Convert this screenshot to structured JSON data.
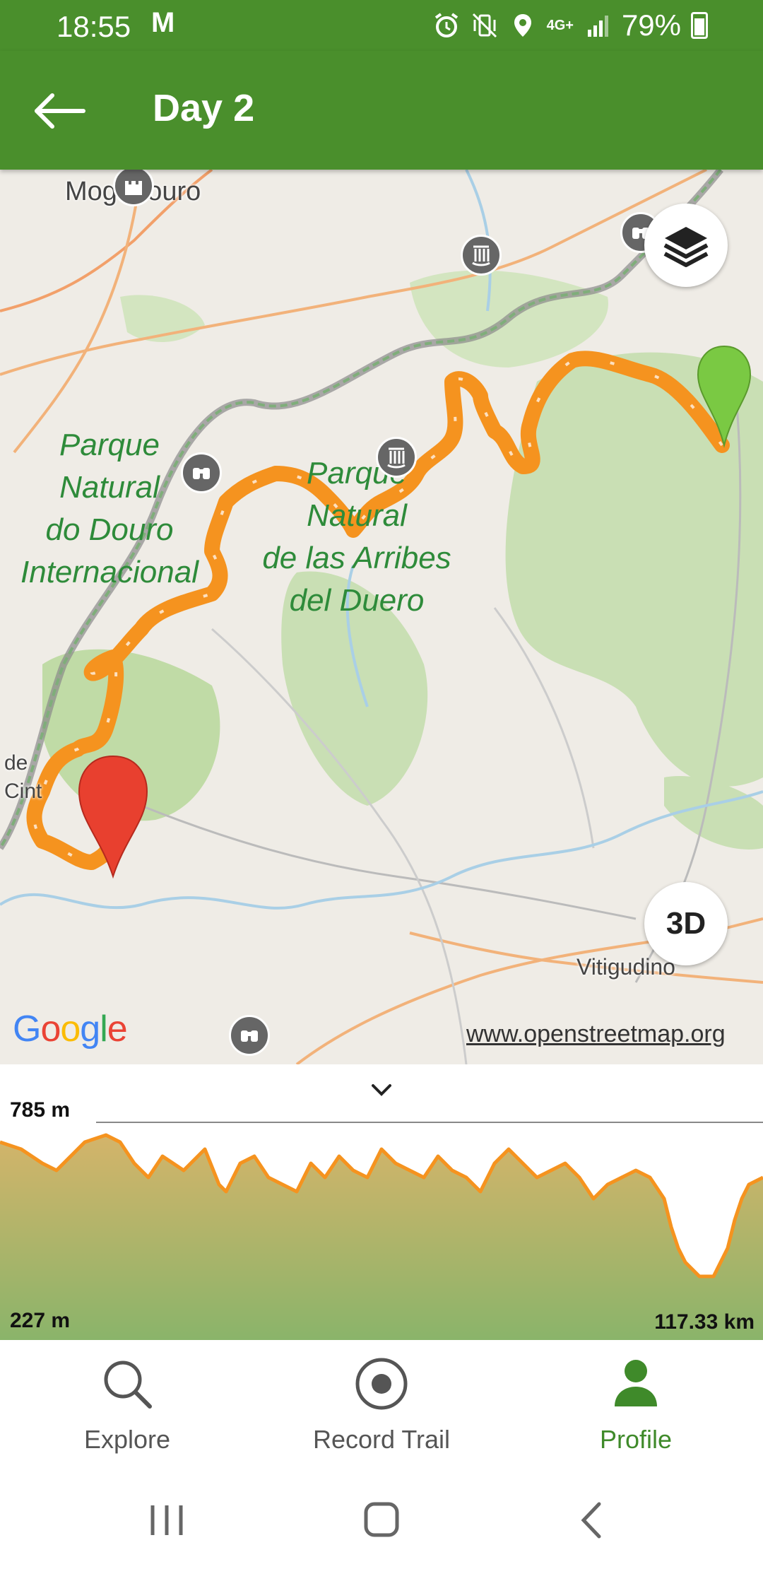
{
  "status_bar": {
    "time": "18:55",
    "notification_letter": "M",
    "network": "4G+",
    "battery": "79%",
    "icons": [
      "alarm-icon",
      "vibrate-icon",
      "location-icon",
      "signal-icon",
      "battery-icon"
    ]
  },
  "app_bar": {
    "title": "Day 2",
    "back_icon": "arrow-left-icon",
    "color": "#4a8f2c"
  },
  "map": {
    "labels": {
      "town_top": "Mogadouro",
      "park_pt": [
        "Parque",
        "Natural",
        "do Douro",
        "Internacional"
      ],
      "park_es": [
        "Parque",
        "Natural",
        "de las Arribes",
        "del Duero"
      ],
      "town_bottom": "Vitigudino",
      "edge_left": [
        "de",
        "Cint"
      ]
    },
    "attribution_logo": "Google",
    "attribution_link": "www.openstreetmap.org",
    "button_3d": "3D",
    "layers_icon": "layers-icon",
    "route_color": "#f5931f",
    "start_marker_color": "#7ac943",
    "end_marker_color": "#e8402f"
  },
  "elevation_profile": {
    "max_label": "785 m",
    "min_label": "227 m",
    "distance_label": "117.33 km",
    "collapse_icon": "chevron-down-icon"
  },
  "bottom_nav": {
    "items": [
      {
        "label": "Explore",
        "icon": "search-icon",
        "active": false
      },
      {
        "label": "Record Trail",
        "icon": "record-icon",
        "active": false
      },
      {
        "label": "Profile",
        "icon": "person-icon",
        "active": true
      }
    ],
    "active_color": "#3f8a2a"
  },
  "system_nav": {
    "icons": [
      "recent-apps-icon",
      "home-icon",
      "back-icon"
    ]
  }
}
